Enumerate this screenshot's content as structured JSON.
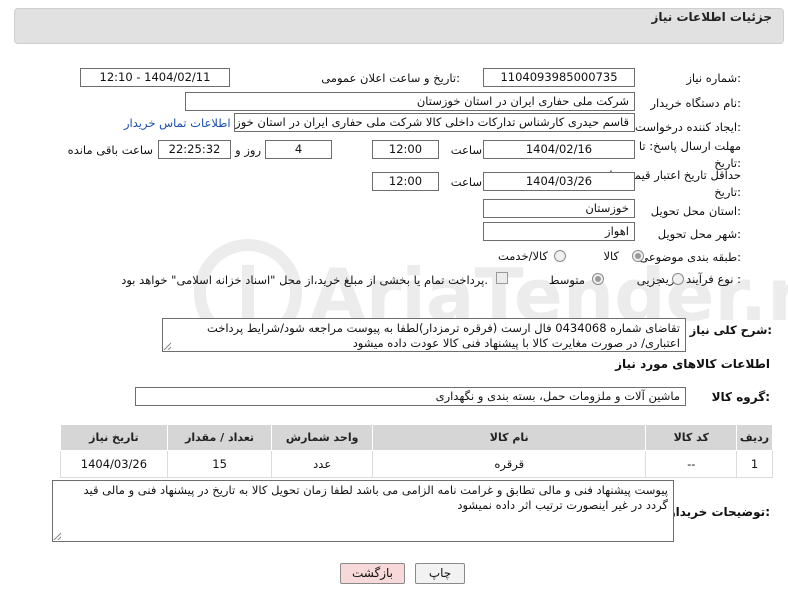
{
  "header": {
    "title": "جزئیات اطلاعات نیاز"
  },
  "form": {
    "need_number": {
      "label": "شماره نیاز:",
      "value": "1104093985000735"
    },
    "announce_datetime": {
      "label": "تاریخ و ساعت اعلان عمومی:",
      "value": "1404/02/11 - 12:10"
    },
    "buyer_org": {
      "label": "نام دستگاه خریدار:",
      "value": "شرکت ملی حفاری ایران در استان خوزستان"
    },
    "requester": {
      "label": "ایجاد کننده درخواست:",
      "value": "قاسم حیدری کارشناس تدارکات داخلی کالا شرکت ملی حفاری ایران در استان خوزستان",
      "contact_link": "اطلاعات تماس خریدار"
    },
    "reply_deadline": {
      "label": "مهلت ارسال پاسخ: تا تاریخ:",
      "date": "1404/02/16",
      "time_label": "ساعت",
      "time": "12:00",
      "days": "4",
      "days_label": "روز و",
      "remaining": "22:25:32",
      "remaining_label": "ساعت باقی مانده"
    },
    "price_validity": {
      "label": "حداقل تاریخ اعتبار قیمت: تا تاریخ:",
      "date": "1404/03/26",
      "time_label": "ساعت",
      "time": "12:00"
    },
    "delivery_province": {
      "label": "استان محل تحویل:",
      "value": "خوزستان"
    },
    "delivery_city": {
      "label": "شهر محل تحویل:",
      "value": "اهواز"
    },
    "category": {
      "label": "طبقه بندی موضوعی:",
      "options": [
        "کالا",
        "کالا/خدمت"
      ],
      "selected": "کالا"
    },
    "purchase_type": {
      "label": "نوع فرآیند خرید :",
      "options": [
        "جزیی",
        "متوسط"
      ],
      "selected": "متوسط",
      "note": "پرداخت تمام یا بخشی از مبلغ خرید،از محل \"اسناد خزانه اسلامی\" خواهد بود."
    },
    "description": {
      "label": "شرح کلی نیاز:",
      "value": "تقاضای شماره 0434068 فال ارست (فرقره ترمزدار)لطفا به پیوست مراجعه شود/شرایط پرداخت اعتباری/ در صورت مغایرت کالا با پیشنهاد فنی کالا عودت داده میشود"
    }
  },
  "goods": {
    "section_title": "اطلاعات کالاهای مورد نیاز",
    "group_label": "گروه کالا:",
    "group_value": "ماشین آلات و ملزومات حمل، بسته بندی و نگهداری",
    "table": {
      "headers": [
        "ردیف",
        "کد کالا",
        "نام کالا",
        "واحد شمارش",
        "تعداد / مقدار",
        "تاریخ نیاز"
      ],
      "rows": [
        [
          "1",
          "--",
          "قرقره",
          "عدد",
          "15",
          "1404/03/26"
        ]
      ]
    }
  },
  "buyer_notes": {
    "label": "توضیحات خریدار:",
    "value": "پیوست پیشنهاد فنی و مالی تطابق و غرامت نامه الزامی می باشد لطفا زمان تحویل کالا به تاریخ در پیشنهاد فنی و مالی قید گردد در غیر اینصورت ترتیب اثر داده نمیشود"
  },
  "buttons": {
    "print": "چاپ",
    "back": "بازگشت"
  },
  "colors": {
    "back_button_bg": "#f8d9d9",
    "link": "#1a4fb0",
    "header_bg": "#e1e1e1",
    "table_header_bg": "#d6d6d6"
  }
}
